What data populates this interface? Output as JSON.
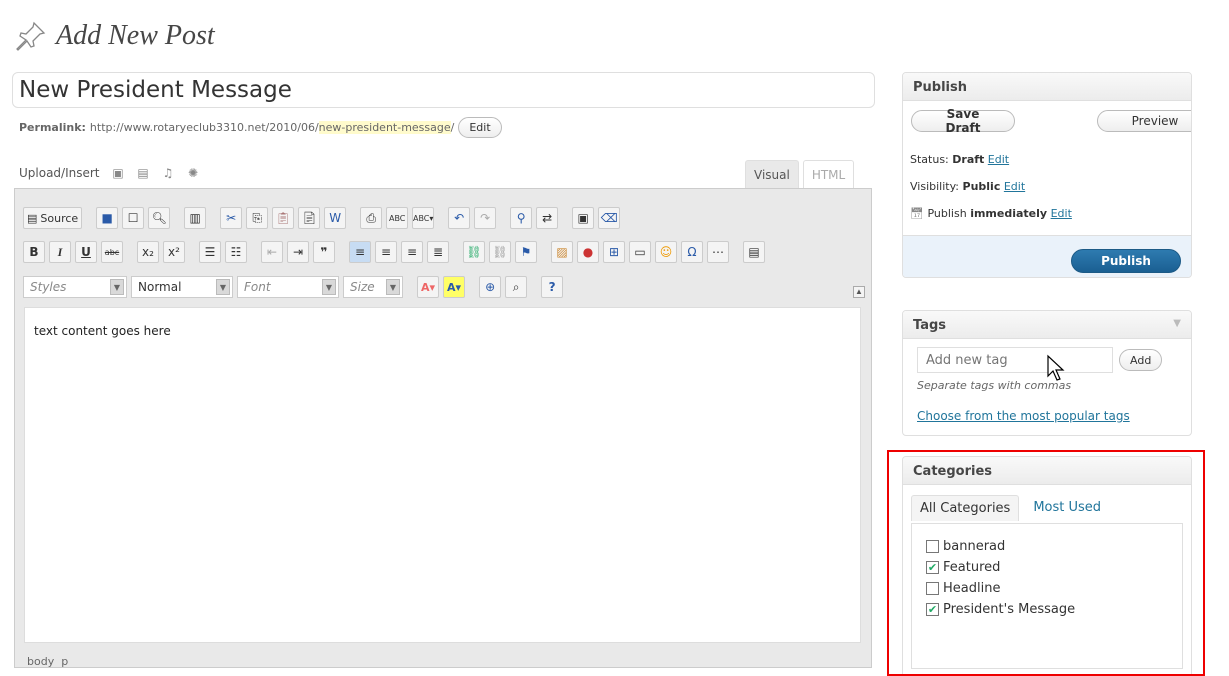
{
  "header": {
    "title": "Add New Post",
    "icon": "pushpin-icon"
  },
  "post": {
    "title": "New President Message",
    "permalink_label": "Permalink:",
    "permalink_base": "http://www.rotaryeclub3310.net/2010/06/",
    "permalink_slug": "new-president-message",
    "permalink_trailing": "/",
    "edit_label": "Edit"
  },
  "editor": {
    "upload_insert": "Upload/Insert",
    "tabs": {
      "visual": "Visual",
      "html": "HTML"
    },
    "source_label": "Source",
    "styles_placeholder": "Styles",
    "format_value": "Normal",
    "font_placeholder": "Font",
    "size_placeholder": "Size",
    "content": "text content goes here",
    "status_path": "body  p"
  },
  "publish": {
    "title": "Publish",
    "save_draft": "Save Draft",
    "preview": "Preview",
    "status_label": "Status:",
    "status_value": "Draft",
    "visibility_label": "Visibility:",
    "visibility_value": "Public",
    "schedule_label": "Publish",
    "schedule_value": "immediately",
    "edit": "Edit",
    "publish_button": "Publish"
  },
  "tags": {
    "title": "Tags",
    "placeholder": "Add new tag",
    "add_button": "Add",
    "hint": "Separate tags with commas",
    "popular_link": "Choose from the most popular tags"
  },
  "categories": {
    "title": "Categories",
    "tab_all": "All Categories",
    "tab_most_used": "Most Used",
    "items": [
      {
        "label": "bannerad",
        "checked": false
      },
      {
        "label": "Featured",
        "checked": true
      },
      {
        "label": "Headline",
        "checked": false
      },
      {
        "label": "President's Message",
        "checked": true
      }
    ]
  },
  "colors": {
    "link": "#21759b",
    "publish_btn": "#1f6aa0",
    "highlight": "#ee0000",
    "slug_bg": "#fffbcc"
  }
}
